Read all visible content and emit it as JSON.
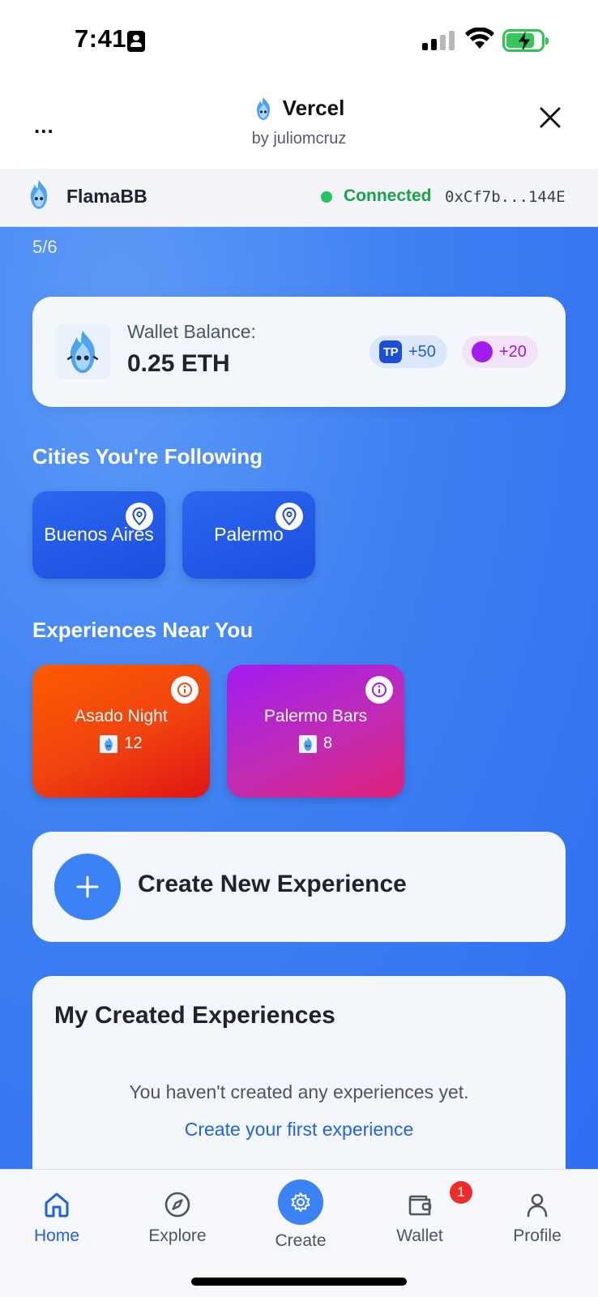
{
  "status_bar": {
    "time": "7:41"
  },
  "app_header": {
    "title": "Vercel",
    "subtitle": "by juliomcruz",
    "menu_label": "..."
  },
  "connection": {
    "name": "FlamaBB",
    "status": "Connected",
    "address": "0xCf7b...144E"
  },
  "progress": {
    "text": "5/6"
  },
  "wallet": {
    "label": "Wallet Balance:",
    "value": "0.25 ETH",
    "tp_badge": "TP",
    "tp_points": "+50",
    "purple_points": "+20"
  },
  "cities": {
    "title": "Cities You're Following",
    "items": [
      {
        "label": "Buenos Aires"
      },
      {
        "label": "Palermo"
      }
    ]
  },
  "experiences": {
    "title": "Experiences Near You",
    "items": [
      {
        "title": "Asado Night",
        "count": "12"
      },
      {
        "title": "Palermo Bars",
        "count": "8"
      }
    ]
  },
  "create": {
    "label": "Create New Experience"
  },
  "my_experiences": {
    "title": "My Created Experiences",
    "empty_text": "You haven't created any experiences yet.",
    "link_text": "Create your first experience"
  },
  "nav": {
    "items": [
      {
        "label": "Home",
        "active": true
      },
      {
        "label": "Explore"
      },
      {
        "label": "Create"
      },
      {
        "label": "Wallet",
        "badge": "1"
      },
      {
        "label": "Profile"
      }
    ]
  },
  "colors": {
    "accent": "#3a82f6",
    "connected": "#16a34a",
    "orange_card": "#ff5a00",
    "purple_card": "#a21cf0",
    "badge": "#ef2b2b"
  }
}
